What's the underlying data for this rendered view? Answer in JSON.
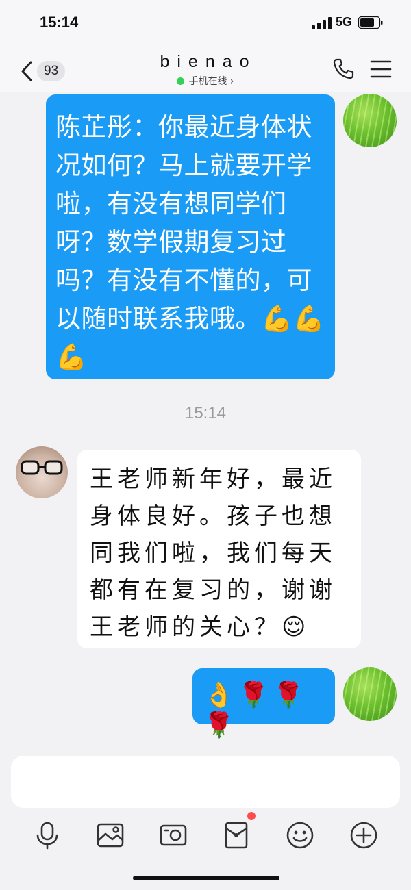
{
  "status_bar": {
    "time": "15:14",
    "network": "5G"
  },
  "header": {
    "unread_count": "93",
    "title": "bienao",
    "presence": "手机在线 ›"
  },
  "messages": [
    {
      "direction": "outgoing",
      "text": "陈芷彤：你最近身体状况如何？马上就要开学啦，有没有想同学们呀？数学假期复习过吗？有没有不懂的，可以随时联系我哦。",
      "emoji": "💪💪💪"
    },
    {
      "type": "timestamp",
      "text": "15:14"
    },
    {
      "direction": "incoming",
      "text": "王老师新年好，最近身体良好。孩子也想同我们啦，我们每天都有在复习的，谢谢王老师的关心？",
      "emoji": "😌"
    },
    {
      "direction": "outgoing",
      "text": "",
      "emoji": "👌🌹🌹🌹"
    }
  ],
  "toolbar": {
    "icons": [
      "microphone-icon",
      "image-icon",
      "camera-icon",
      "red-packet-icon",
      "emoji-icon",
      "plus-icon"
    ]
  },
  "colors": {
    "outgoing_bubble": "#1a9bf6",
    "incoming_bubble": "#ffffff",
    "background": "#f2f2f4",
    "online_dot": "#34d058"
  }
}
